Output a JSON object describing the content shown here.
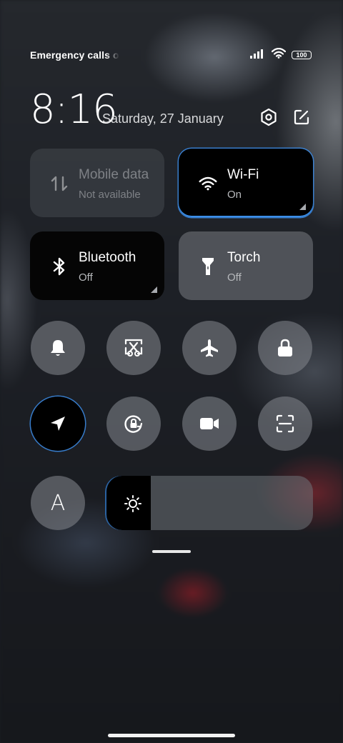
{
  "status": {
    "carrier": "Emergency calls only",
    "battery": "100"
  },
  "header": {
    "time": "8:16",
    "date": "Saturday, 27 January"
  },
  "tiles": {
    "mobile_data": {
      "title": "Mobile data",
      "subtitle": "Not available"
    },
    "wifi": {
      "title": "Wi-Fi",
      "subtitle": "On"
    },
    "bluetooth": {
      "title": "Bluetooth",
      "subtitle": "Off"
    },
    "torch": {
      "title": "Torch",
      "subtitle": "Off"
    }
  },
  "font_button": {
    "label": "A"
  },
  "brightness": {
    "level": 0.22
  },
  "colors": {
    "accent": "#3b8ee8"
  }
}
